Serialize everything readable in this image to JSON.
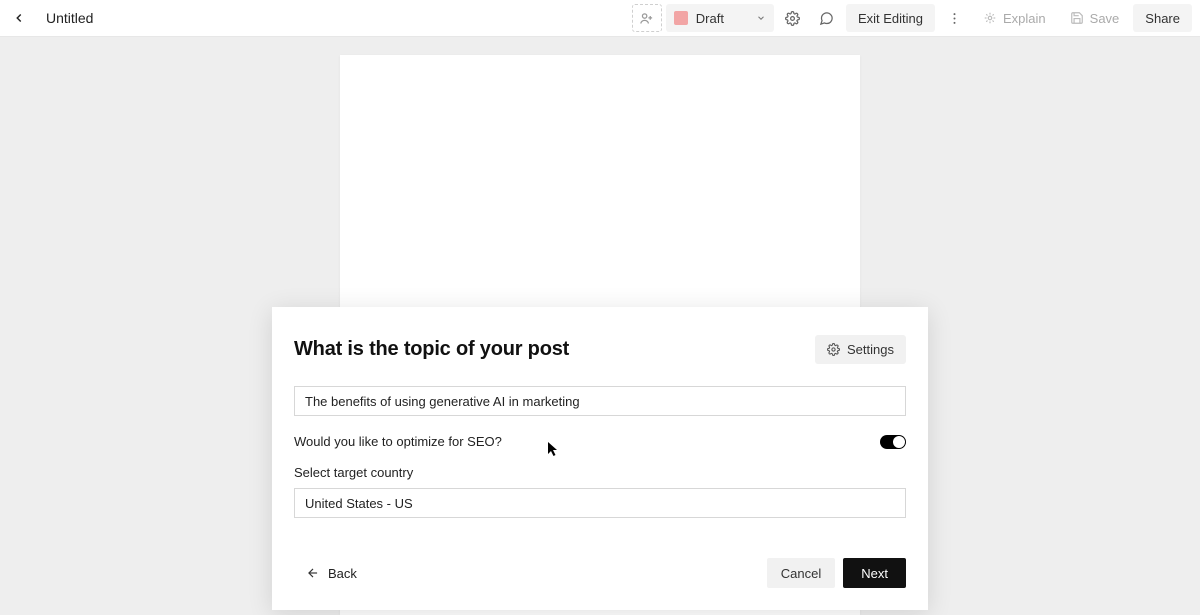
{
  "header": {
    "title": "Untitled",
    "draft_label": "Draft",
    "exit_label": "Exit Editing",
    "explain_label": "Explain",
    "save_label": "Save",
    "share_label": "Share"
  },
  "modal": {
    "title": "What is the topic of your post",
    "settings_label": "Settings",
    "topic_value": "The benefits of using generative AI in marketing",
    "seo_label": "Would you like to optimize for SEO?",
    "seo_on": true,
    "country_label": "Select target country",
    "country_value": "United States - US",
    "back_label": "Back",
    "cancel_label": "Cancel",
    "next_label": "Next"
  }
}
